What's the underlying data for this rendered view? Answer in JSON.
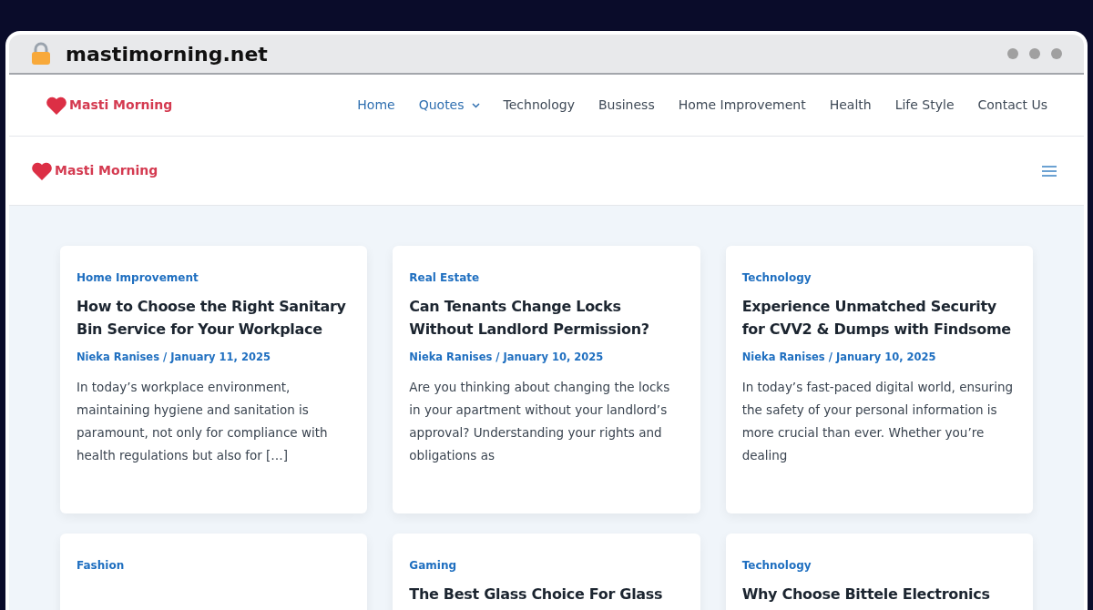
{
  "browser": {
    "address": "mastimorning.net"
  },
  "header": {
    "logo": "Masti Morning",
    "nav": [
      {
        "label": "Home",
        "selected": true,
        "dropdown": false
      },
      {
        "label": "Quotes",
        "selected": true,
        "dropdown": true
      },
      {
        "label": "Technology",
        "selected": false,
        "dropdown": false
      },
      {
        "label": "Business",
        "selected": false,
        "dropdown": false
      },
      {
        "label": "Home Improvement",
        "selected": false,
        "dropdown": false
      },
      {
        "label": "Health",
        "selected": false,
        "dropdown": false
      },
      {
        "label": "Life Style",
        "selected": false,
        "dropdown": false
      },
      {
        "label": "Contact Us",
        "selected": false,
        "dropdown": false
      }
    ]
  },
  "mobile_header": {
    "logo": "Masti Morning"
  },
  "posts": [
    {
      "category": "Home Improvement",
      "title": "How to Choose the Right Sanitary Bin Service for Your Workplace",
      "meta": "Nieka Ranises / January 11, 2025",
      "excerpt": "In today’s workplace environment, maintaining hygiene and sanitation is paramount, not only for compliance with health regulations but also for […]"
    },
    {
      "category": "Real Estate",
      "title": "Can Tenants Change Locks Without Landlord Permission?",
      "meta": "Nieka Ranises / January 10, 2025",
      "excerpt": "Are you thinking about changing the locks in your apartment without your landlord’s approval? Understanding your rights and obligations as"
    },
    {
      "category": "Technology",
      "title": "Experience Unmatched Security for CVV2 & Dumps with Findsome",
      "meta": "Nieka Ranises / January 10, 2025",
      "excerpt": "In today’s fast-paced digital world, ensuring the safety of your personal information is more crucial than ever. Whether you’re dealing"
    },
    {
      "category": "Fashion"
    },
    {
      "category": "Gaming",
      "title": "The Best Glass Choice For Glass"
    },
    {
      "category": "Technology",
      "title": "Why Choose Bittele Electronics"
    }
  ]
}
